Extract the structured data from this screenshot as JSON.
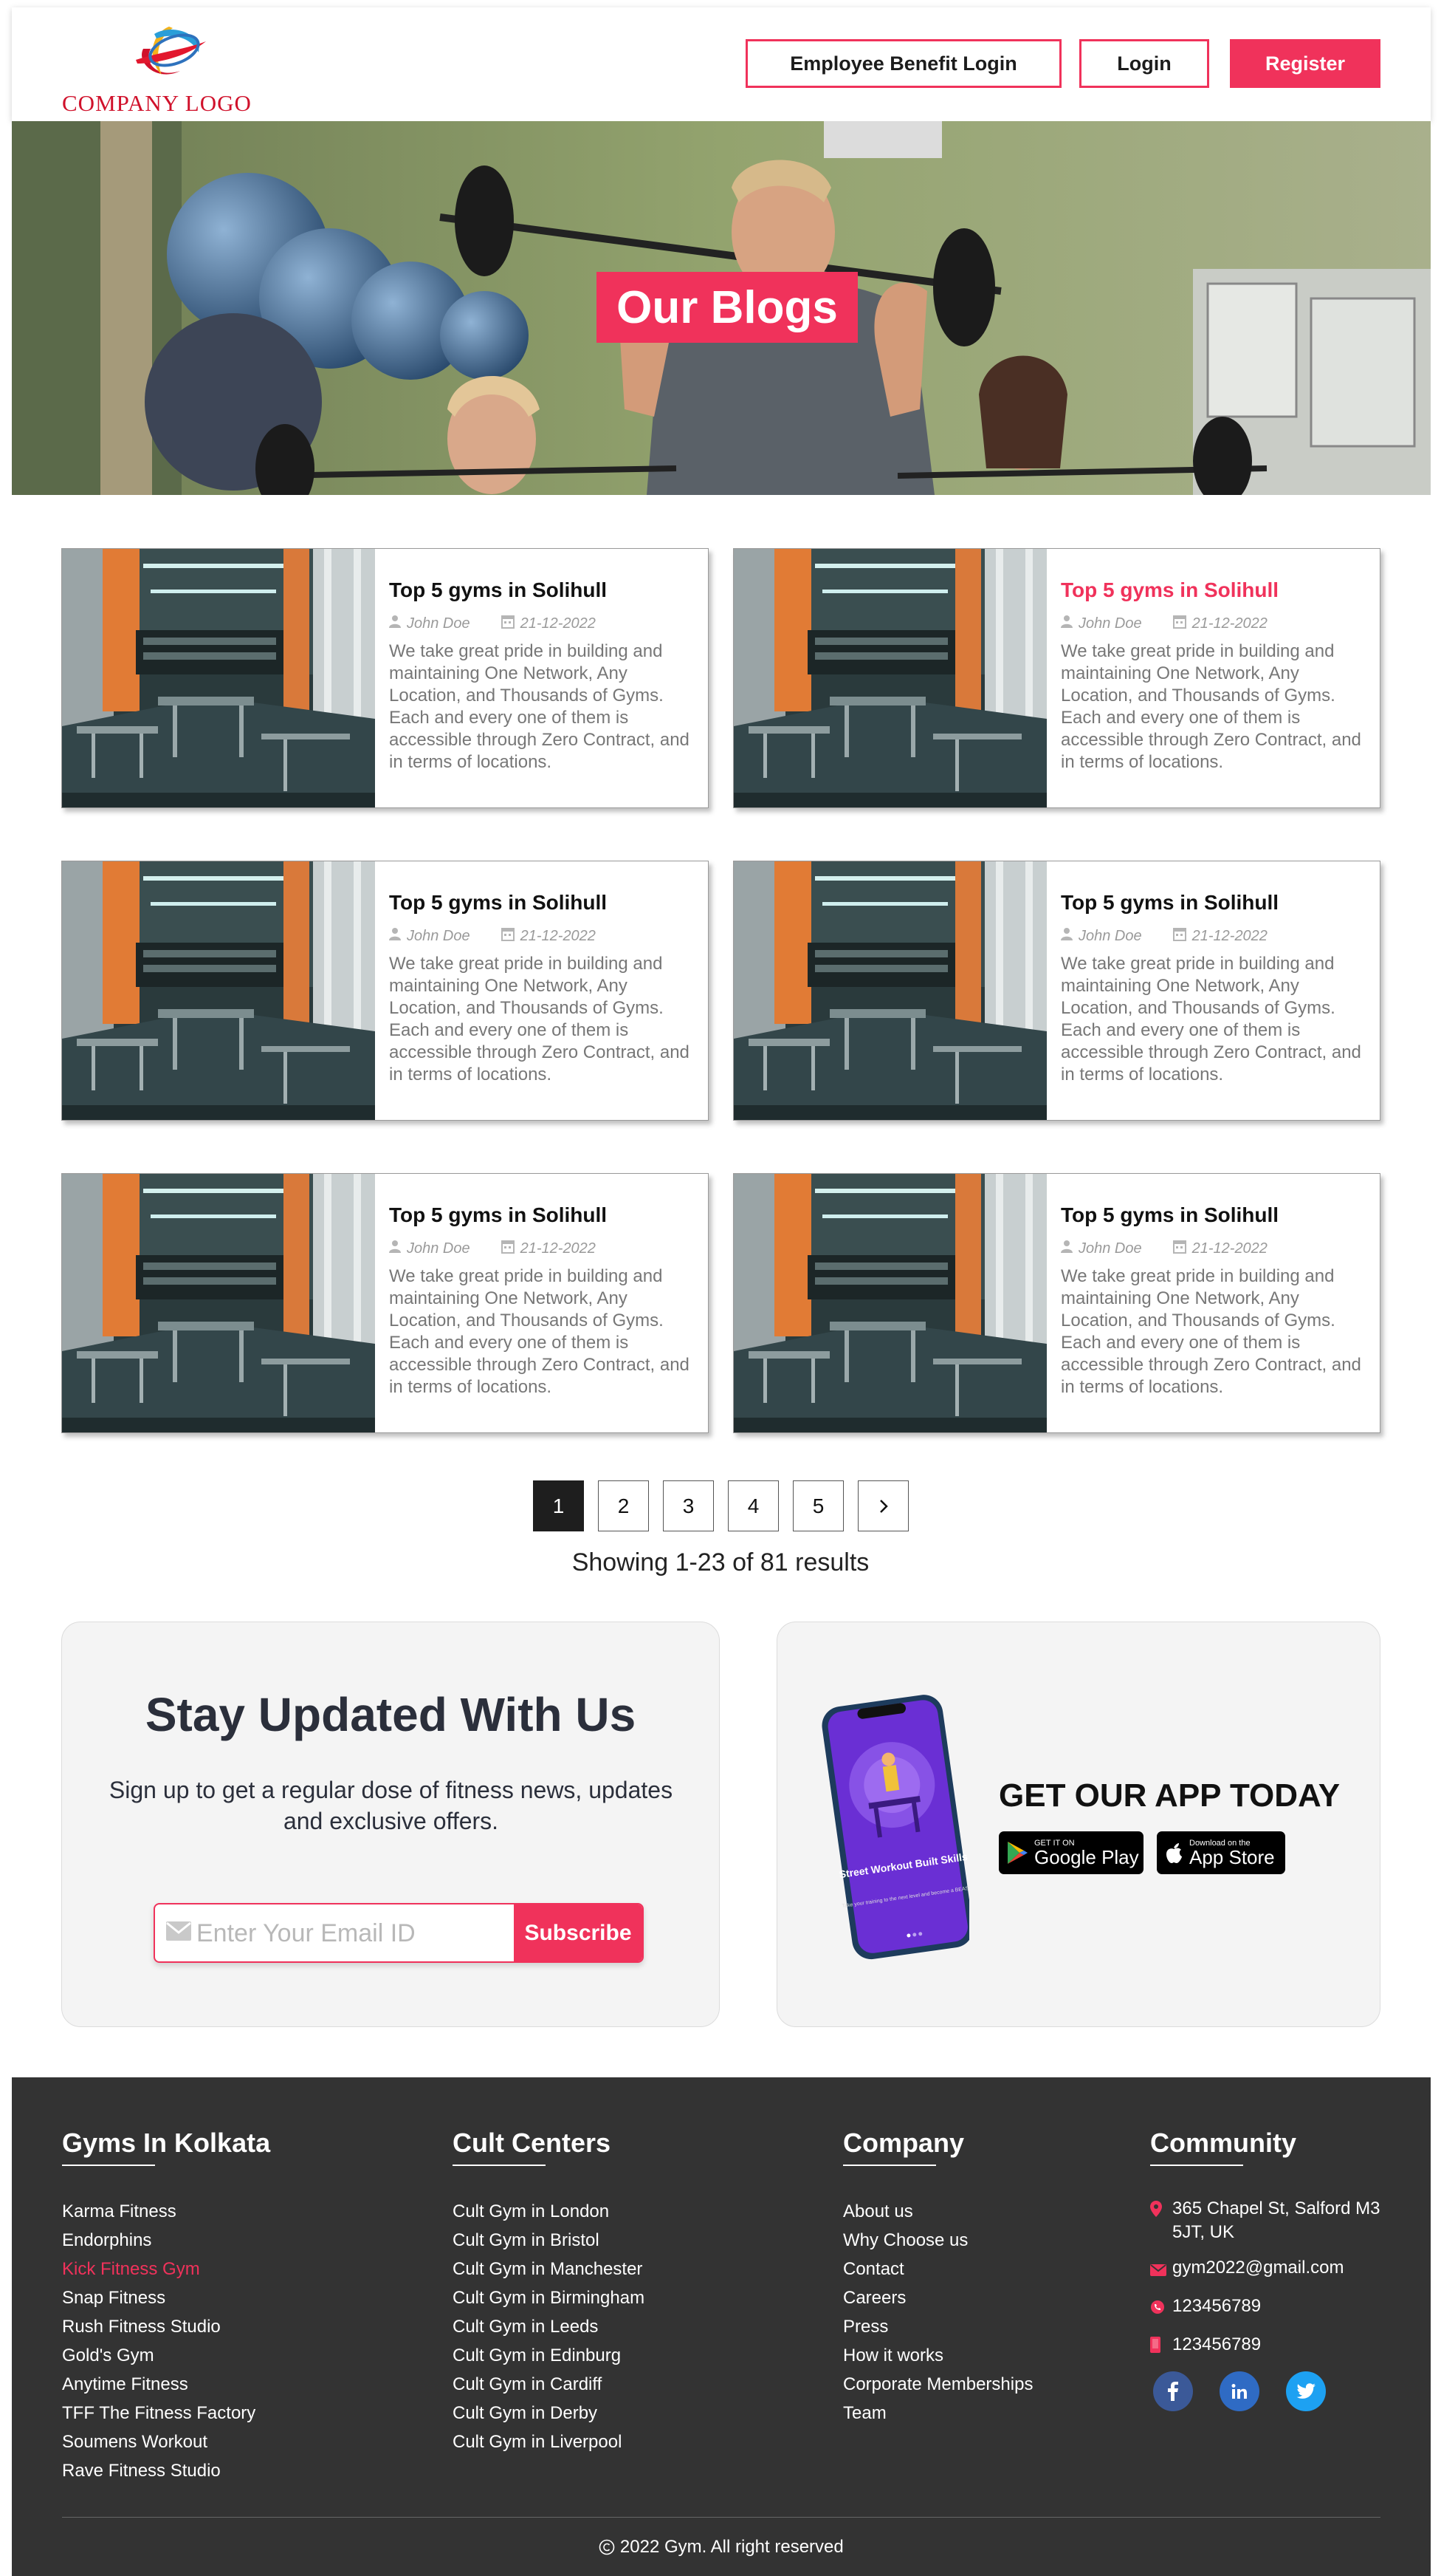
{
  "header": {
    "logo_text": "COMPANY LOGO",
    "buttons": {
      "employee_login": "Employee Benefit Login",
      "login": "Login",
      "register": "Register"
    }
  },
  "hero": {
    "title": "Our Blogs"
  },
  "blogs": [
    {
      "title": "Top 5 gyms in Solihull",
      "author": "John Doe",
      "date": "21-12-2022",
      "excerpt": "We take great pride in building and maintaining One Network, Any Location, and Thousands of Gyms. Each and every one of them is accessible through Zero Contract, and in terms of locations."
    },
    {
      "title": "Top 5 gyms in Solihull",
      "author": "John Doe",
      "date": "21-12-2022",
      "excerpt": "We take great pride in building and maintaining One Network, Any Location, and Thousands of Gyms. Each and every one of them is accessible through Zero Contract, and in terms of locations."
    },
    {
      "title": "Top 5 gyms in Solihull",
      "author": "John Doe",
      "date": "21-12-2022",
      "excerpt": "We take great pride in building and maintaining One Network, Any Location, and Thousands of Gyms. Each and every one of them is accessible through Zero Contract, and in terms of locations."
    },
    {
      "title": "Top 5 gyms in Solihull",
      "author": "John Doe",
      "date": "21-12-2022",
      "excerpt": "We take great pride in building and maintaining One Network, Any Location, and Thousands of Gyms. Each and every one of them is accessible through Zero Contract, and in terms of locations."
    },
    {
      "title": "Top 5 gyms in Solihull",
      "author": "John Doe",
      "date": "21-12-2022",
      "excerpt": "We take great pride in building and maintaining One Network, Any Location, and Thousands of Gyms. Each and every one of them is accessible through Zero Contract, and in terms of locations."
    },
    {
      "title": "Top 5 gyms in Solihull",
      "author": "John Doe",
      "date": "21-12-2022",
      "excerpt": "We take great pride in building and maintaining One Network, Any Location, and Thousands of Gyms. Each and every one of them is accessible through Zero Contract, and in terms of locations."
    }
  ],
  "pagination": {
    "pages": [
      "1",
      "2",
      "3",
      "4",
      "5"
    ],
    "active": "1",
    "next_icon": "chevron-right-icon",
    "results_text": "Showing 1-23 of 81 results"
  },
  "newsletter": {
    "title": "Stay Updated With Us",
    "subtitle": "Sign up to get a regular dose of fitness news, updates and exclusive offers.",
    "email_placeholder": "Enter Your Email ID",
    "subscribe_label": "Subscribe"
  },
  "app_promo": {
    "title": "GET OUR APP TODAY",
    "phone_screen_title": "Street Workout Built Skills",
    "phone_screen_sub": "Take your training to the next level and become a BEAST!",
    "google_play": {
      "small": "GET IT ON",
      "big": "Google Play"
    },
    "app_store": {
      "small": "Download on the",
      "big": "App Store"
    }
  },
  "footer": {
    "gyms": {
      "heading": "Gyms In Kolkata",
      "items": [
        "Karma Fitness",
        "Endorphins",
        "Kick Fitness Gym",
        "Snap Fitness",
        "Rush Fitness Studio",
        "Gold's Gym",
        "Anytime Fitness",
        "TFF The Fitness Factory",
        "Soumens Workout",
        "Rave Fitness Studio"
      ],
      "highlighted": "Kick Fitness Gym"
    },
    "cult": {
      "heading": "Cult Centers",
      "items": [
        "Cult Gym in London",
        "Cult Gym in Bristol",
        "Cult Gym in Manchester",
        "Cult Gym in Birmingham",
        "Cult Gym in Leeds",
        "Cult Gym in Edinburg",
        "Cult Gym in Cardiff",
        "Cult Gym in Derby",
        "Cult Gym in Liverpool"
      ]
    },
    "company": {
      "heading": "Company",
      "items": [
        "About us",
        "Why Choose us",
        "Contact",
        "Careers",
        "Press",
        "How it works",
        "Corporate Memberships",
        "Team"
      ]
    },
    "community": {
      "heading": "Community",
      "address": "365 Chapel St, Salford M3 5JT, UK",
      "email": "gym2022@gmail.com",
      "whatsapp": "123456789",
      "phone": "123456789",
      "social": [
        "facebook-icon",
        "linkedin-icon",
        "twitter-icon"
      ]
    },
    "copyright": "2022 Gym. All right reserved"
  },
  "colors": {
    "accent": "#f0325b",
    "footer_bg": "#333333",
    "panel_bg": "#f4f4f4",
    "facebook": "#3b5998",
    "linkedin": "#2f6bc4",
    "twitter": "#1da1f2"
  }
}
